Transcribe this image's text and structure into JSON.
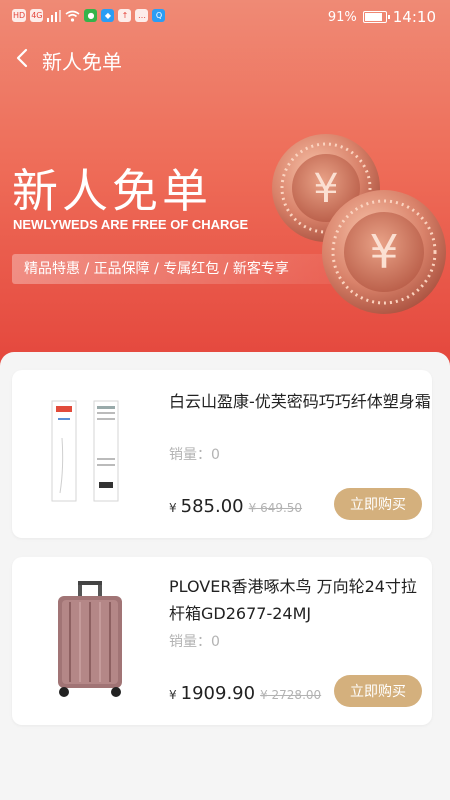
{
  "status_bar": {
    "left_icons": [
      "HD",
      "4G",
      "signal-icon",
      "wifi-icon",
      "wechat-icon",
      "app-icon",
      "upload-icon",
      "message-icon",
      "search-app-icon"
    ],
    "battery_text": "91%",
    "battery_level": 0.91,
    "time": "14:10"
  },
  "nav": {
    "title": "新人免单"
  },
  "banner": {
    "title": "新人免单",
    "subtitle": "NEWLYWEDS ARE FREE OF CHARGE",
    "tags": "精品特惠 / 正品保障 / 专属红包 / 新客专享"
  },
  "products": [
    {
      "title": "白云山盈康-优芙密码巧巧纤体塑身霜",
      "sales": "销量：0",
      "currency": "¥",
      "price": "585.00",
      "original_price": "¥ 649.50",
      "buy_label": "立即购买"
    },
    {
      "title": "PLOVER香港啄木鸟 万向轮24寸拉杆箱GD2677-24MJ",
      "sales": "销量：0",
      "currency": "¥",
      "price": "1909.90",
      "original_price": "¥ 2728.00",
      "buy_label": "立即购买"
    }
  ],
  "colors": {
    "hero_top": "#ef8a75",
    "hero_bottom": "#e4463c",
    "buy_button": "#d4b07d",
    "background": "#f3f3f3"
  }
}
